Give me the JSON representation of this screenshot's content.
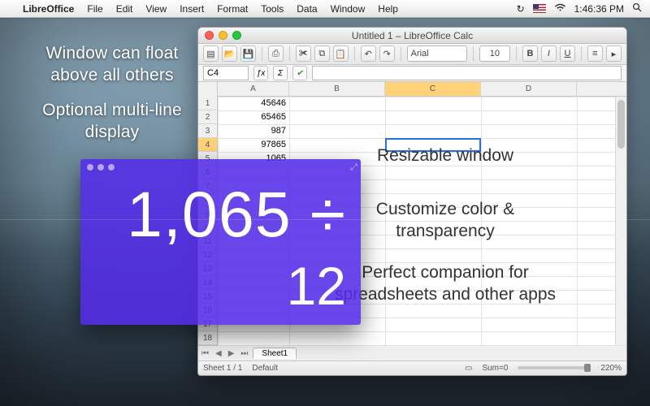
{
  "menubar": {
    "app_name": "LibreOffice",
    "items": [
      "File",
      "Edit",
      "View",
      "Insert",
      "Format",
      "Tools",
      "Data",
      "Window",
      "Help"
    ],
    "clock": "1:46:36 PM"
  },
  "captions": {
    "float": "Window can float above all others",
    "multiline": "Optional multi-line display",
    "resizable": "Resizable window",
    "customize": "Customize color & transparency",
    "companion": "Perfect companion for spreadsheets and other apps"
  },
  "calc_window": {
    "title": "Untitled 1 – LibreOffice Calc",
    "font_name": "Arial",
    "font_size": "10",
    "name_box": "C4",
    "columns": [
      "A",
      "B",
      "C",
      "D"
    ],
    "selected_row": 4,
    "selected_col": "C",
    "col_a_values": [
      "45646",
      "65465",
      "987",
      "97865",
      "1065"
    ],
    "sheet_tab": "Sheet1",
    "status_sheet": "Sheet 1 / 1",
    "status_style": "Default",
    "status_sum": "Sum=0",
    "status_zoom": "220%"
  },
  "calculator": {
    "line1": "1,065  ÷",
    "line2": "12"
  }
}
